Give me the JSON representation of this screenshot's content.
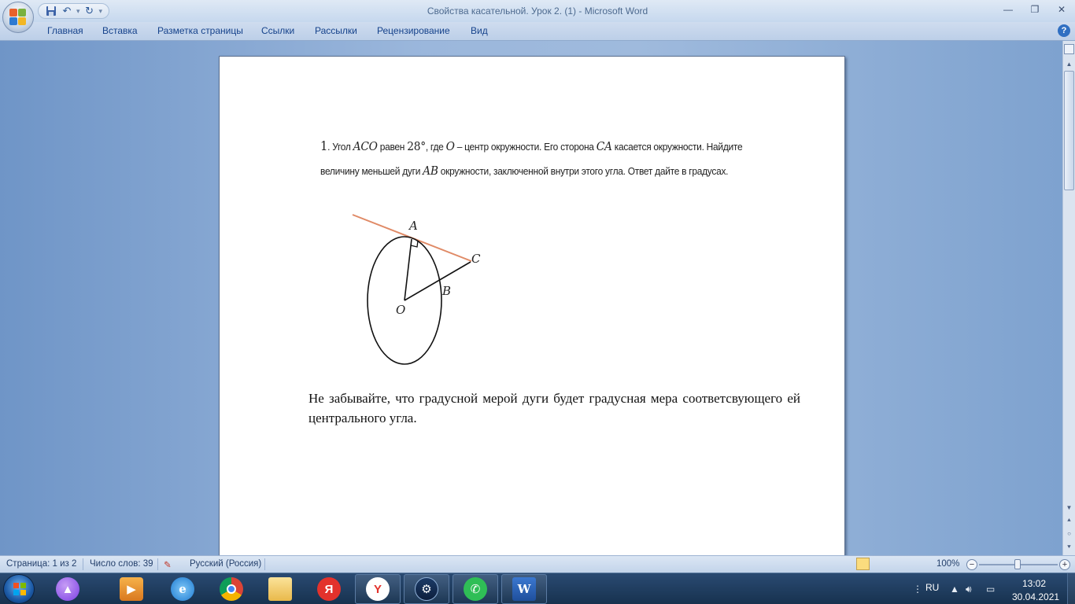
{
  "window": {
    "title": "Свойства касательной. Урок 2. (1) - Microsoft Word",
    "controls": {
      "minimize": "—",
      "restore": "❐",
      "close": "✕"
    }
  },
  "quick_access": [
    "save-icon",
    "undo-icon",
    "redo-icon",
    "customize-icon"
  ],
  "ribbon_tabs": [
    "Главная",
    "Вставка",
    "Разметка страницы",
    "Ссылки",
    "Рассылки",
    "Рецензирование",
    "Вид"
  ],
  "document": {
    "task_number": "1",
    "task_parts": {
      "p1": ". Угол ",
      "m1": "ACO",
      "p2": " равен ",
      "m2": "28°",
      "p3": ", где ",
      "m3": "O",
      "p4": " – центр окружности. Его сторона ",
      "m4": "CA",
      "p5": " касается окружности. Найдите величину меньшей дуги ",
      "m5": "AB",
      "p6": " окружности, заключенной внутри этого угла. Ответ дайте в градусах."
    },
    "figure_labels": {
      "A": "A",
      "C": "C",
      "B": "B",
      "O": "O"
    },
    "note": "Не забывайте, что градусной мерой дуги будет градусная мера соответсвующего ей центрального угла."
  },
  "status_bar": {
    "page": "Страница: 1 из 2",
    "words": "Число слов: 39",
    "language": "Русский (Россия)",
    "zoom": "100%"
  },
  "taskbar": {
    "apps": [
      "alice-icon",
      "media-player-icon",
      "internet-explorer-icon",
      "chrome-icon",
      "file-explorer-icon",
      "yandex-icon",
      "yandex-browser-icon",
      "steam-icon",
      "whatsapp-icon",
      "word-icon"
    ],
    "language": "RU",
    "time": "13:02",
    "date": "30.04.2021"
  },
  "colors": {
    "tangent_line": "#e08a66",
    "accent": "#15428b",
    "word_blue": "#2b5797"
  }
}
